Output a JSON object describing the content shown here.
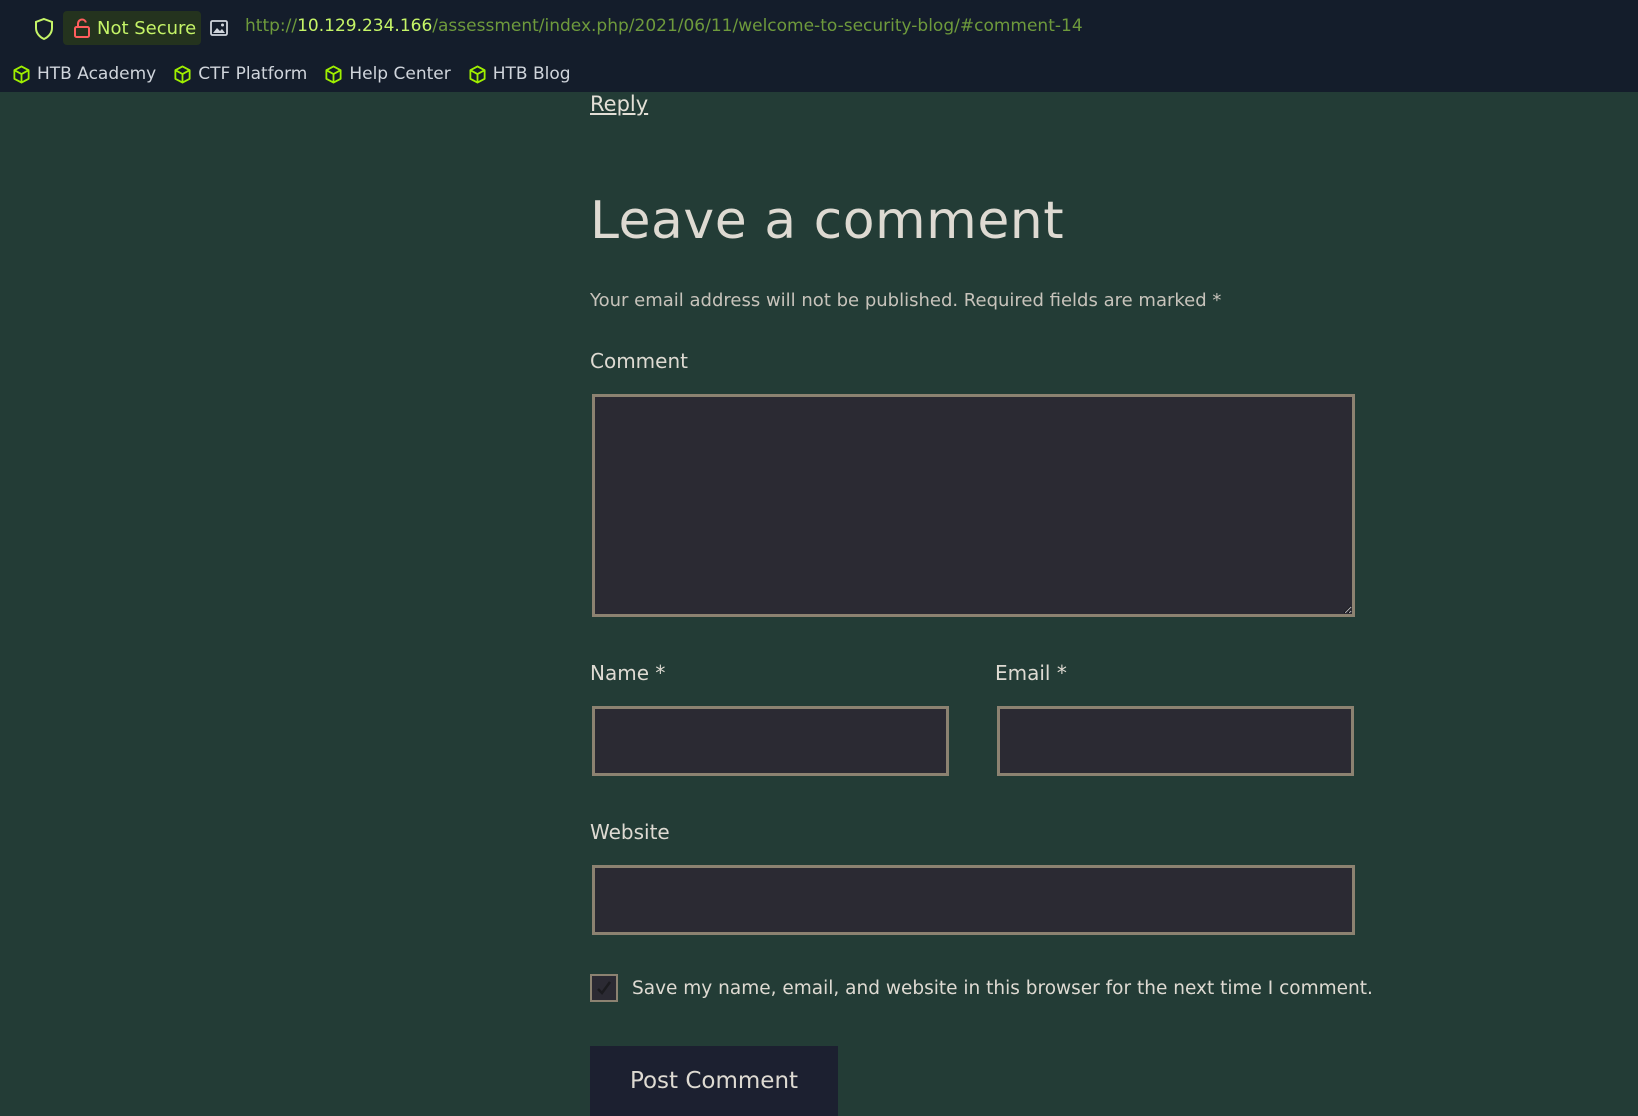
{
  "browser": {
    "security_label": "Not Secure",
    "url_prefix": "http://",
    "url_host": "10.129.234.166",
    "url_path": "/assessment/index.php/2021/06/11/welcome-to-security-blog/#comment-14",
    "bookmarks": [
      {
        "label": "HTB Academy",
        "icon": "htb-cube-icon"
      },
      {
        "label": "CTF Platform",
        "icon": "htb-cube-icon"
      },
      {
        "label": "Help Center",
        "icon": "htb-cube-icon"
      },
      {
        "label": "HTB Blog",
        "icon": "htb-cube-icon"
      }
    ],
    "accent_color": "#9fef00"
  },
  "page": {
    "reply_link": "Reply",
    "heading": "Leave a comment",
    "notes": "Your email address will not be published. Required fields are marked *",
    "comment_label": "Comment",
    "comment_value": "",
    "name_label": "Name *",
    "name_value": "",
    "email_label": "Email *",
    "email_value": "",
    "website_label": "Website",
    "website_value": "",
    "save_checkbox_checked": true,
    "save_label": "Save my name, email, and website in this browser for the next time I comment.",
    "submit_label": "Post Comment"
  }
}
